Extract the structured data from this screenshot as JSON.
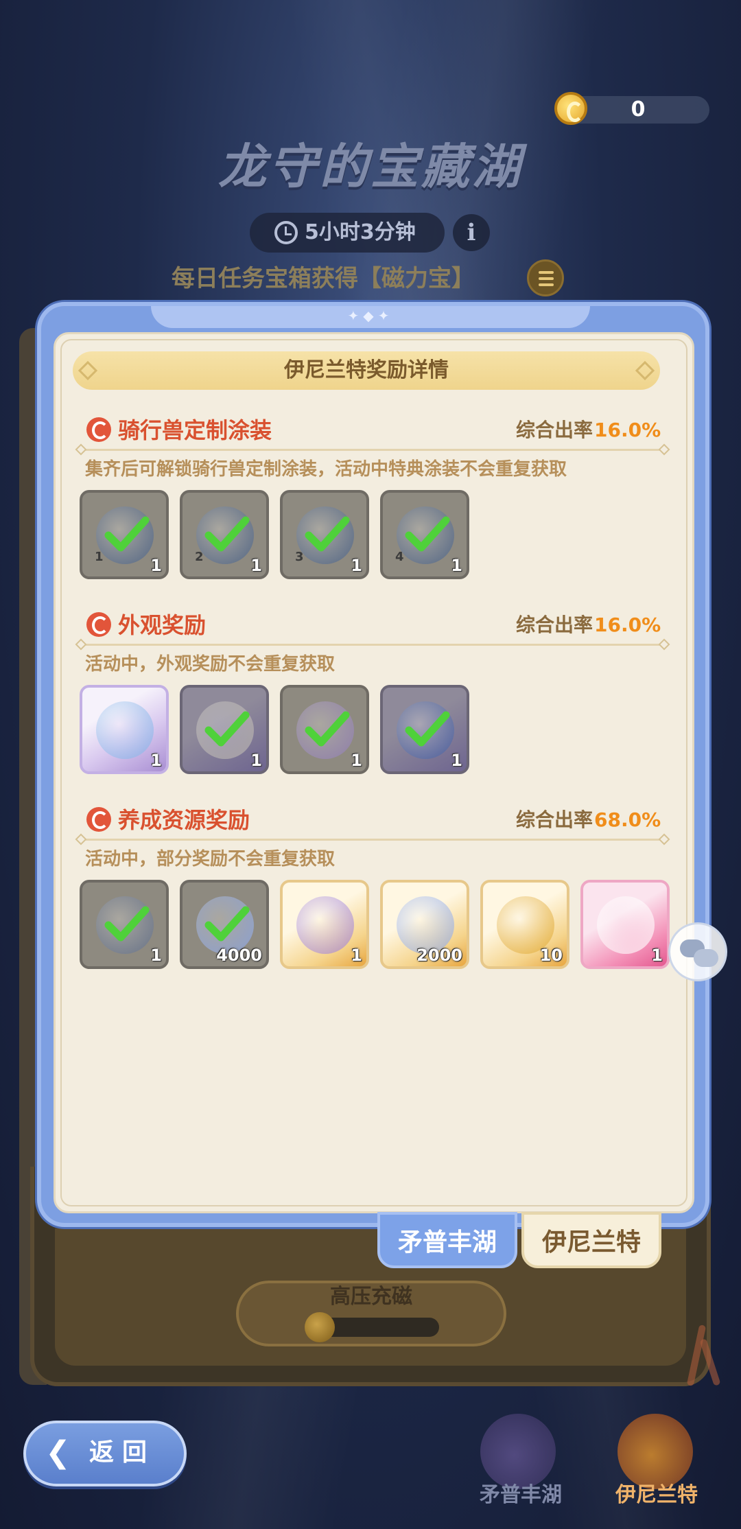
{
  "header": {
    "coin_count": "0",
    "event_title": "龙守的宝藏湖",
    "timer": "5小时3分钟",
    "daily_text": "每日任务宝箱获得【磁力宝】"
  },
  "background": {
    "charge_label": "高压充磁",
    "charge_progress": 0.1
  },
  "modal": {
    "title": "伊尼兰特奖励详情",
    "sections": [
      {
        "title": "骑行兽定制涂装",
        "rate_label": "综合出率",
        "rate_value": "16.0%",
        "desc": "集齐后可解锁骑行兽定制涂装，活动中特典涂装不会重复获取",
        "items": [
          {
            "index": "1",
            "count": "1",
            "obtained": true,
            "style": "gray",
            "icon": "mount-skin-icon"
          },
          {
            "index": "2",
            "count": "1",
            "obtained": true,
            "style": "gray",
            "icon": "mount-skin-icon"
          },
          {
            "index": "3",
            "count": "1",
            "obtained": true,
            "style": "gray",
            "icon": "mount-skin-icon"
          },
          {
            "index": "4",
            "count": "1",
            "obtained": true,
            "style": "gray",
            "icon": "mount-skin-icon"
          }
        ]
      },
      {
        "title": "外观奖励",
        "rate_label": "综合出率",
        "rate_value": "16.0%",
        "desc": "活动中，外观奖励不会重复获取",
        "items": [
          {
            "count": "1",
            "obtained": false,
            "style": "purple",
            "icon": "water-drop-icon"
          },
          {
            "count": "1",
            "obtained": true,
            "style": "purple-gray",
            "icon": "hat-icon"
          },
          {
            "count": "1",
            "obtained": true,
            "style": "gray",
            "icon": "wreath-icon"
          },
          {
            "count": "1",
            "obtained": true,
            "style": "purple-gray",
            "icon": "frame-icon"
          }
        ]
      },
      {
        "title": "养成资源奖励",
        "rate_label": "综合出率",
        "rate_value": "68.0%",
        "desc": "活动中，部分奖励不会重复获取",
        "items": [
          {
            "count": "1",
            "obtained": true,
            "style": "gray",
            "icon": "boots-icon"
          },
          {
            "count": "4000",
            "obtained": true,
            "style": "gray",
            "icon": "star-crystal-icon"
          },
          {
            "count": "1",
            "obtained": false,
            "style": "gold",
            "icon": "treasure-chest-icon"
          },
          {
            "count": "2000",
            "obtained": false,
            "style": "gold",
            "icon": "star-crystal-icon"
          },
          {
            "count": "10",
            "obtained": false,
            "style": "gold",
            "icon": "bell-icon"
          },
          {
            "count": "1",
            "obtained": false,
            "style": "pink",
            "icon": "cat-avatar-icon"
          }
        ]
      }
    ]
  },
  "tabs": [
    {
      "label": "矛普丰湖",
      "active": true
    },
    {
      "label": "伊尼兰特",
      "active": false
    }
  ],
  "bottom": {
    "back_label": "返回",
    "lakes": [
      {
        "label": "矛普丰湖"
      },
      {
        "label": "伊尼兰特"
      }
    ]
  },
  "colors": {
    "accent_red": "#d9512f",
    "rate_orange": "#f08d1a",
    "frame_blue": "#7d9fe2",
    "check_green": "#4fd13a"
  }
}
